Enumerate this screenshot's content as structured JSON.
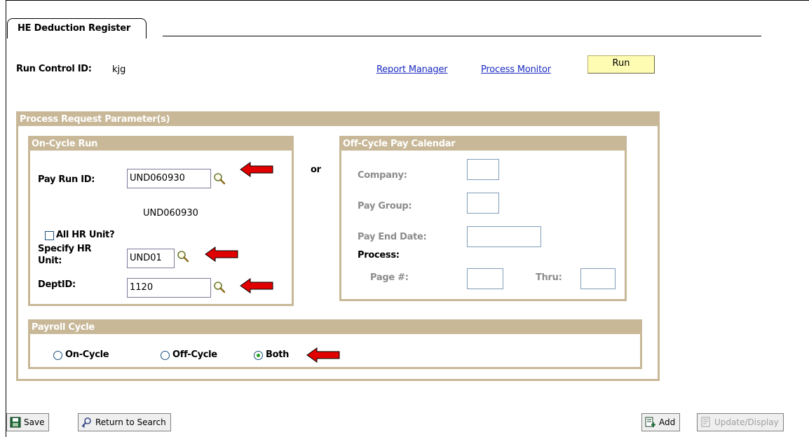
{
  "tab": {
    "label": "HE Deduction Register"
  },
  "run_control": {
    "label": "Run Control ID:",
    "value": "kjg"
  },
  "links": {
    "report_manager": "Report Manager",
    "process_monitor": "Process Monitor"
  },
  "run_button": "Run",
  "process_request": {
    "title": "Process Request Parameter(s)",
    "or_label": "or",
    "on_cycle": {
      "title": "On-Cycle Run",
      "pay_run_label": "Pay Run ID:",
      "pay_run_value": "UND060930",
      "pay_run_description": "UND060930",
      "all_hr_unit_label": "All HR Unit?",
      "all_hr_unit_checked": false,
      "specify_hr_unit_label_1": "Specify HR",
      "specify_hr_unit_label_2": "Unit:",
      "specify_hr_unit_value": "UND01",
      "deptid_label": "DeptID:",
      "deptid_value": "1120"
    },
    "off_cycle": {
      "title": "Off-Cycle Pay Calendar",
      "company_label": "Company:",
      "company_value": "",
      "pay_group_label": "Pay Group:",
      "pay_group_value": "",
      "pay_end_date_label": "Pay End Date:",
      "pay_end_date_value": "",
      "process_label": "Process:",
      "page_label": "Page #:",
      "page_value": "",
      "thru_label": "Thru:",
      "thru_value": ""
    },
    "payroll_cycle": {
      "title": "Payroll Cycle",
      "options": [
        "On-Cycle",
        "Off-Cycle",
        "Both"
      ],
      "selected": "Both"
    }
  },
  "footer": {
    "save": "Save",
    "return_to_search": "Return to Search",
    "add": "Add",
    "update_display": "Update/Display"
  },
  "colors": {
    "group_header": "#c8b898",
    "link": "#1a2bc0",
    "run_button": "#fefbb3",
    "annotation_arrow": "#e00000",
    "radio_selected": "#21a121"
  }
}
